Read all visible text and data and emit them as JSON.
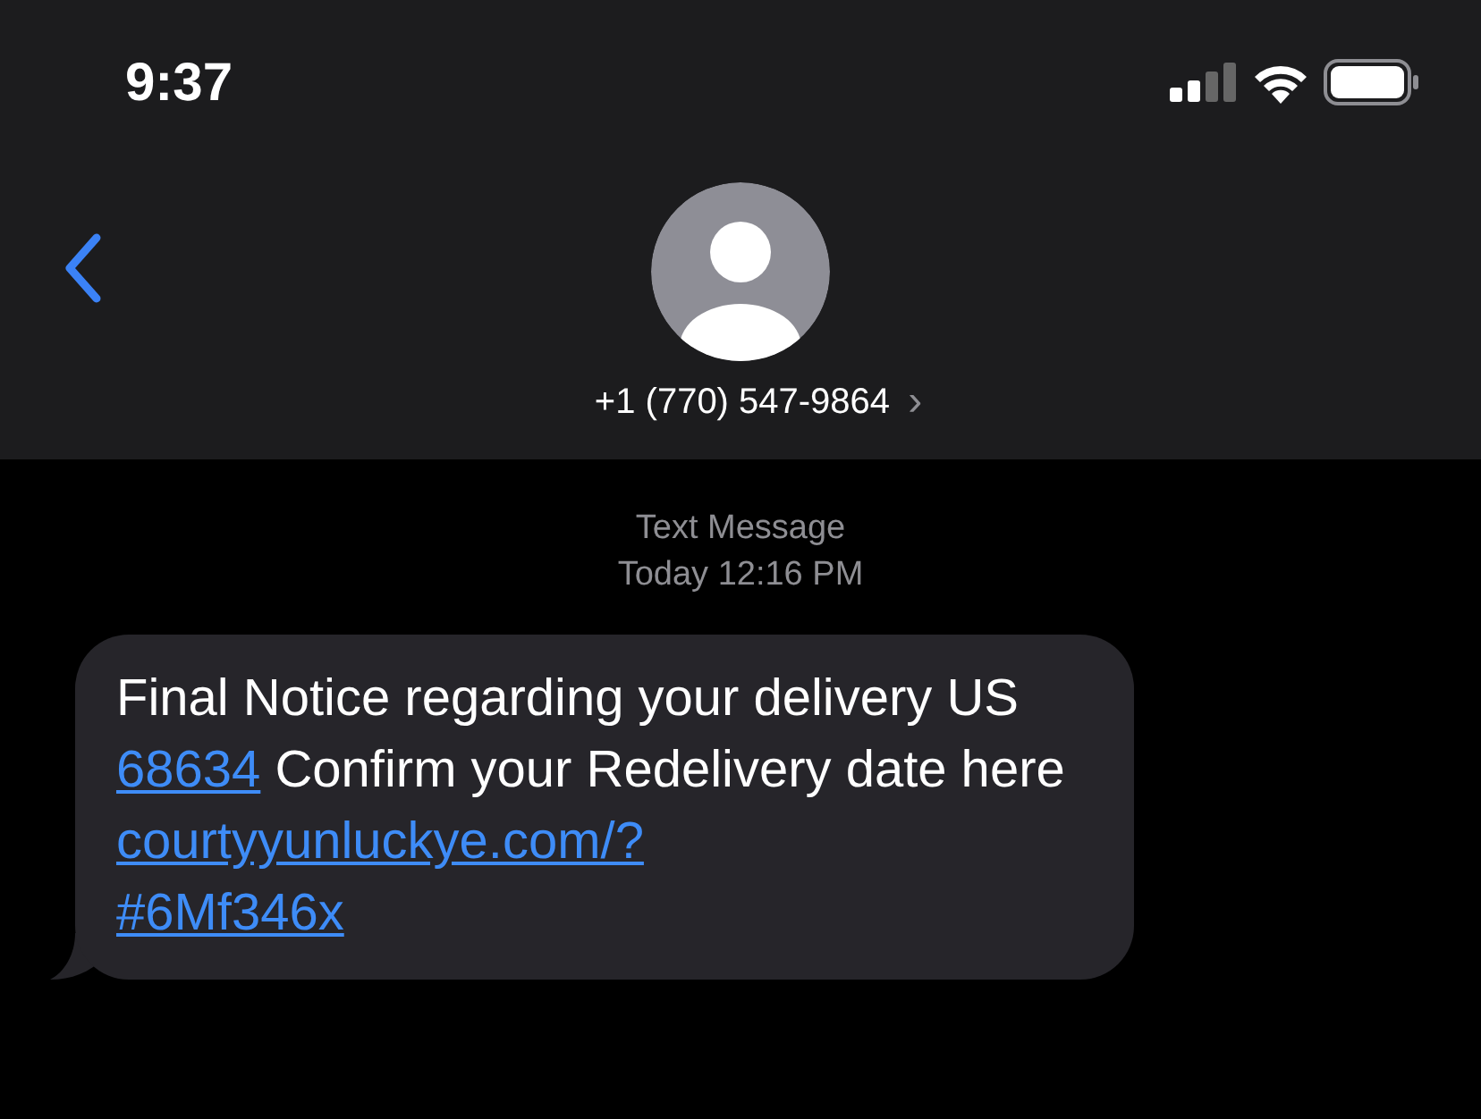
{
  "status_bar": {
    "time": "9:37"
  },
  "contact": {
    "number": "+1 (770) 547-9864",
    "chevron": "›"
  },
  "conversation": {
    "service": "Text Message",
    "timestamp": "Today 12:16 PM"
  },
  "messages": [
    {
      "parts": [
        {
          "kind": "text",
          "text": "Final Notice regarding your delivery US "
        },
        {
          "kind": "link",
          "text": "68634"
        },
        {
          "kind": "text",
          "text": " Confirm your Redelivery date here "
        },
        {
          "kind": "link",
          "text": "courtyyunluckye.com/?"
        },
        {
          "kind": "break"
        },
        {
          "kind": "link",
          "text": "#6Mf346x"
        }
      ]
    }
  ]
}
